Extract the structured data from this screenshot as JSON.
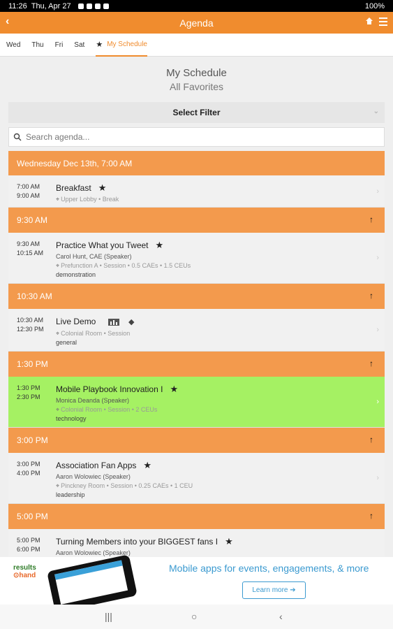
{
  "status_bar": {
    "time": "11:26",
    "date": "Thu, Apr 27",
    "battery": "100%"
  },
  "app_bar": {
    "title": "Agenda"
  },
  "tabs": [
    {
      "label": "Wed"
    },
    {
      "label": "Thu"
    },
    {
      "label": "Fri"
    },
    {
      "label": "Sat"
    },
    {
      "label": "My Schedule",
      "active": true
    }
  ],
  "header": {
    "title": "My Schedule",
    "subtitle": "All Favorites"
  },
  "filter": {
    "label": "Select Filter"
  },
  "search": {
    "placeholder": "Search agenda..."
  },
  "agenda": {
    "day_header": "Wednesday Dec 13th, 7:00 AM",
    "blocks": [
      {
        "time_header": null,
        "sessions": [
          {
            "start": "7:00 AM",
            "end": "9:00 AM",
            "title": "Breakfast",
            "starred": true,
            "speaker": null,
            "location": "Upper Lobby • Break",
            "tag": null
          }
        ]
      },
      {
        "time_header": "9:30 AM",
        "sessions": [
          {
            "start": "9:30 AM",
            "end": "10:15 AM",
            "title": "Practice What you Tweet",
            "starred": true,
            "speaker": "Carol Hunt, CAE (Speaker)",
            "location": "Prefunction A • Session • 0.5 CAEs • 1.5 CEUs",
            "tag": "demonstration"
          }
        ]
      },
      {
        "time_header": "10:30 AM",
        "sessions": [
          {
            "start": "10:30 AM",
            "end": "12:30 PM",
            "title": "Live Demo",
            "starred": false,
            "speaker": null,
            "location": "Colonial Room • Session",
            "tag": "general"
          }
        ]
      },
      {
        "time_header": "1:30 PM",
        "sessions": [
          {
            "start": "1:30 PM",
            "end": "2:30 PM",
            "title": "Mobile Playbook Innovation I",
            "starred": true,
            "speaker": "Monica Deanda (Speaker)",
            "location": "Colonial Room • Session • 2 CEUs",
            "tag": "technology",
            "highlight": true
          }
        ]
      },
      {
        "time_header": "3:00 PM",
        "sessions": [
          {
            "start": "3:00 PM",
            "end": "4:00 PM",
            "title": "Association Fan Apps",
            "starred": true,
            "speaker": "Aaron Wolowiec (Speaker)",
            "location": "Pinckney Room • Session • 0.25 CAEs • 1 CEU",
            "tag": "leadership"
          }
        ]
      },
      {
        "time_header": "5:00 PM",
        "sessions": [
          {
            "start": "5:00 PM",
            "end": "6:00 PM",
            "title": "Turning Members into your BIGGEST fans I",
            "starred": true,
            "speaker": "Aaron Wolowiec (Speaker)",
            "location": "",
            "tag": ""
          }
        ]
      }
    ]
  },
  "banner": {
    "logo_top": "results",
    "logo_bottom": "hand",
    "tagline": "Mobile apps for events, engagements, & more",
    "cta": "Learn more"
  }
}
